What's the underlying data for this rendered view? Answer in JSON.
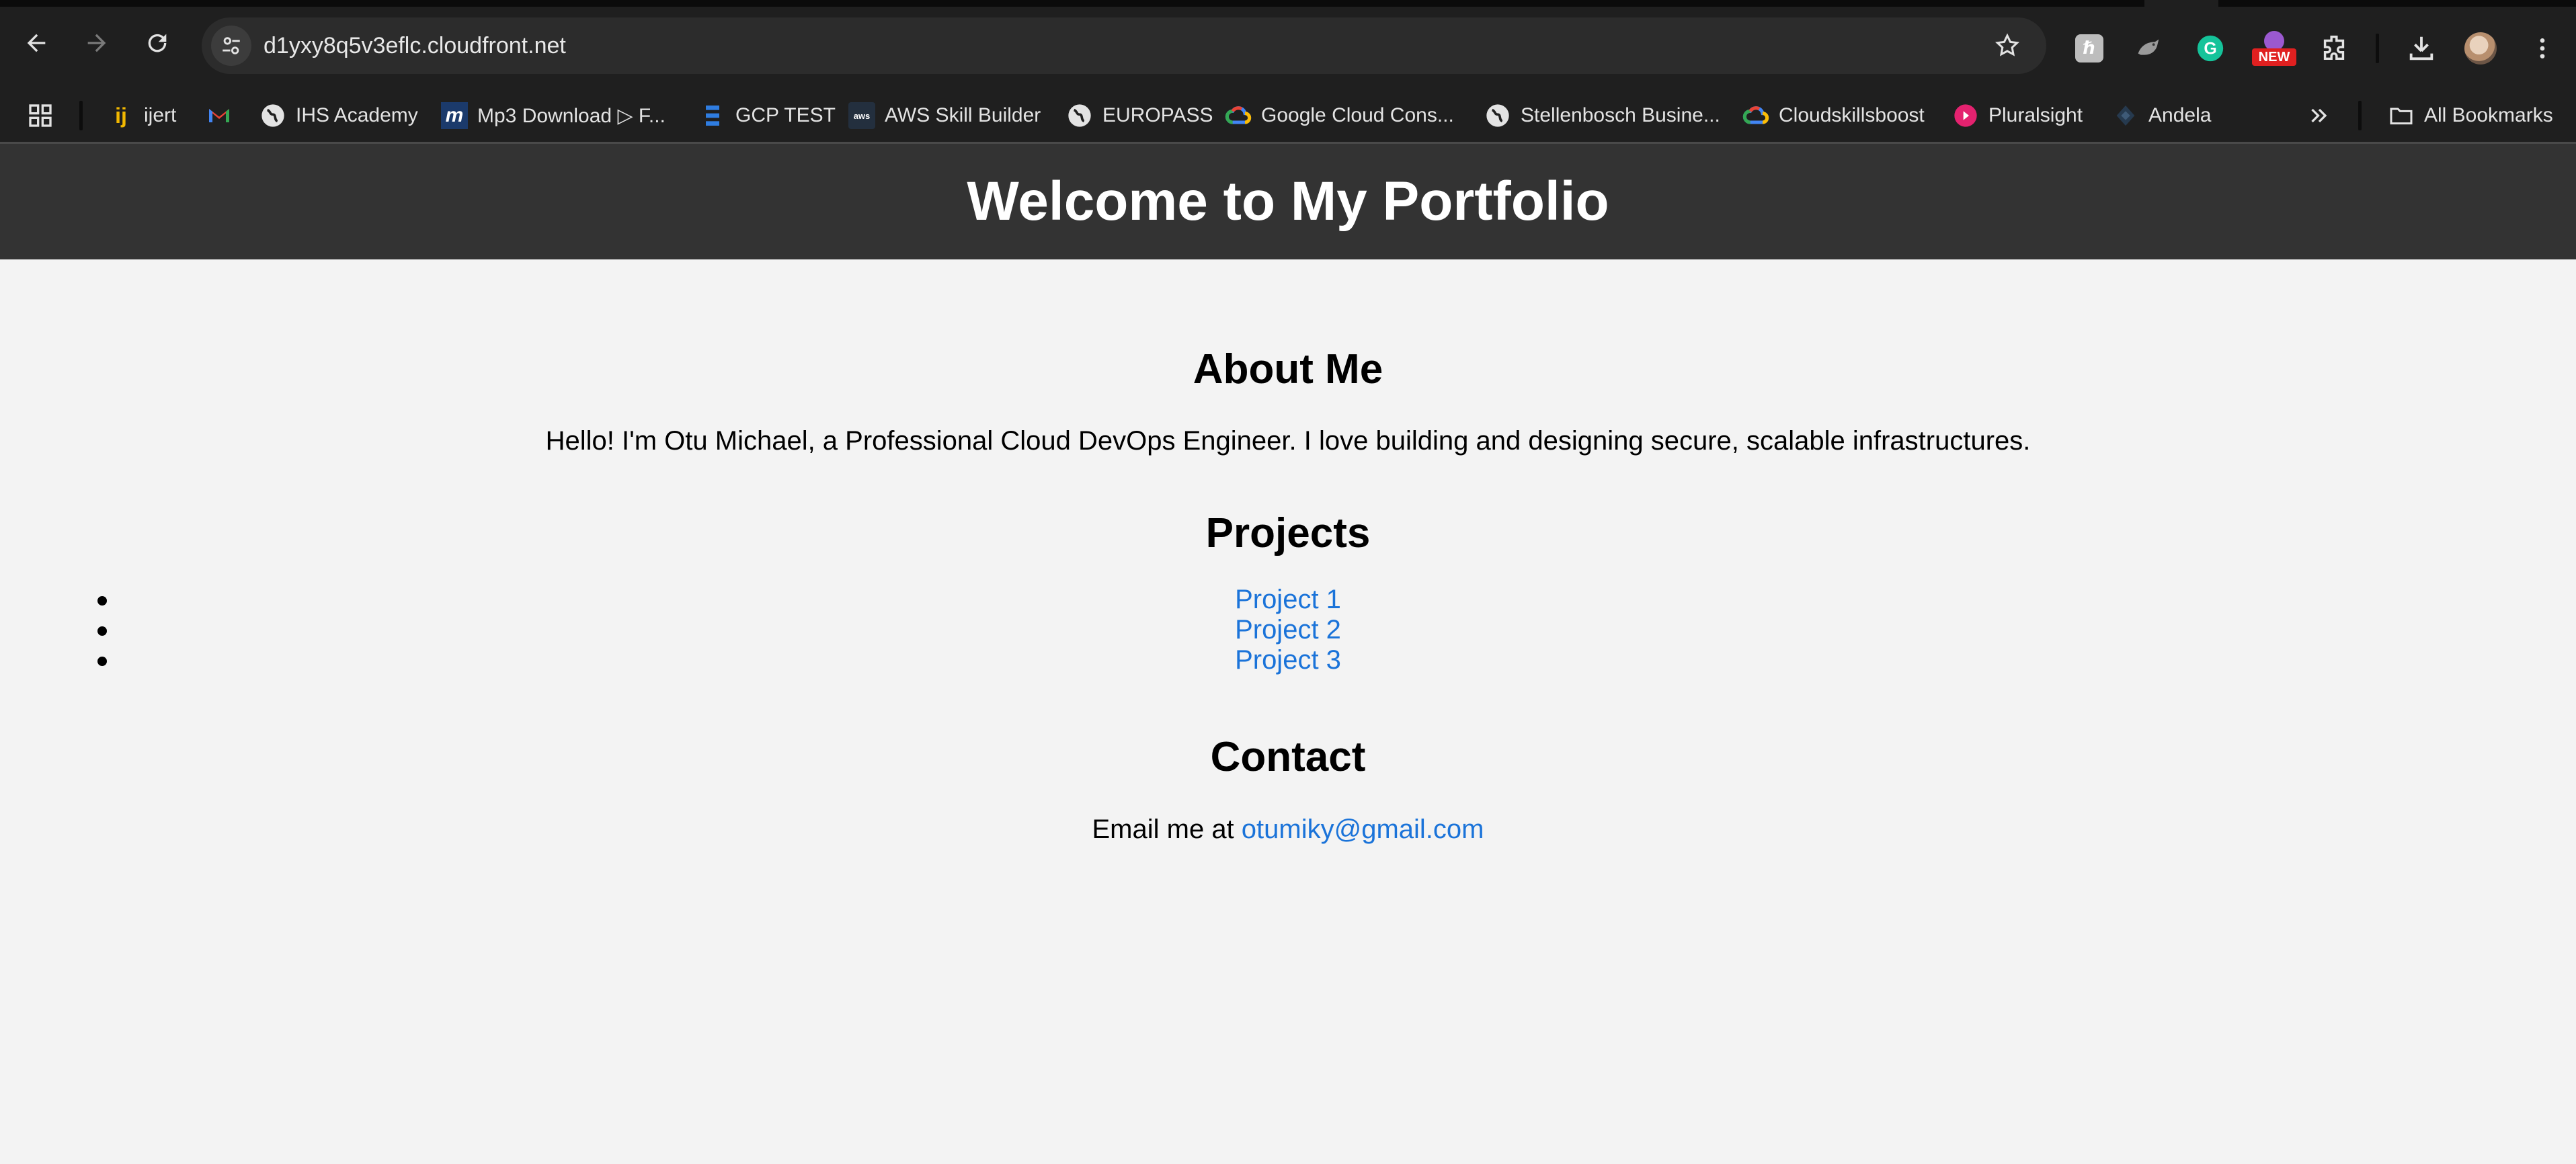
{
  "browser": {
    "url": "d1yxy8q5v3eflc.cloudfront.net",
    "new_badge": "NEW",
    "bookmarks": [
      {
        "label": "ijert"
      },
      {
        "label": ""
      },
      {
        "label": "IHS Academy"
      },
      {
        "label": "Mp3 Download ▷ F..."
      },
      {
        "label": "GCP TEST"
      },
      {
        "label": "AWS Skill Builder"
      },
      {
        "label": "EUROPASS"
      },
      {
        "label": "Google Cloud Cons..."
      },
      {
        "label": "Stellenbosch Busine..."
      },
      {
        "label": "Cloudskillsboost"
      },
      {
        "label": "Pluralsight"
      },
      {
        "label": "Andela"
      }
    ],
    "all_bookmarks": "All Bookmarks"
  },
  "page": {
    "title": "Welcome to My Portfolio",
    "about": {
      "heading": "About Me",
      "text": "Hello! I'm Otu Michael, a Professional Cloud DevOps Engineer. I love building and designing secure, scalable infrastructures."
    },
    "projects": {
      "heading": "Projects",
      "items": [
        "Project 1",
        "Project 2",
        "Project 3"
      ]
    },
    "contact": {
      "heading": "Contact",
      "prefix": "Email me at ",
      "email": "otumiky@gmail.com"
    }
  },
  "colors": {
    "header_bg": "#333333",
    "page_bg": "#f3f3f3",
    "link": "#1a73d9",
    "chrome_bg": "#1f1f1f"
  }
}
